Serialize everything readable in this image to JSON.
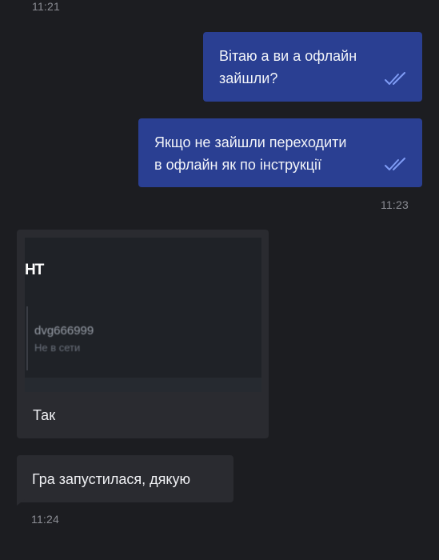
{
  "messages": {
    "top_time": "11:21",
    "out1": {
      "text_line1": "Вітаю а ви а офлайн",
      "text_line2": "зайшли?"
    },
    "out2": {
      "text_line1": "Якщо не зайшли переходити",
      "text_line2": "в офлайн як по інструкції"
    },
    "out_time": "11:23",
    "in1": {
      "preview": {
        "title": "НТ",
        "username": "dvg666999",
        "status": "Не в сети"
      },
      "caption": "Так"
    },
    "in2": {
      "text": "Гра запустилася, дякую"
    },
    "in_time": "11:24"
  },
  "colors": {
    "background": "#1c1d21",
    "outgoing_bubble": "#2a3f92",
    "incoming_bubble": "#2a2b30",
    "read_checks": "#7f9cf5"
  },
  "icons": {
    "read_receipt": "double-check-icon"
  }
}
